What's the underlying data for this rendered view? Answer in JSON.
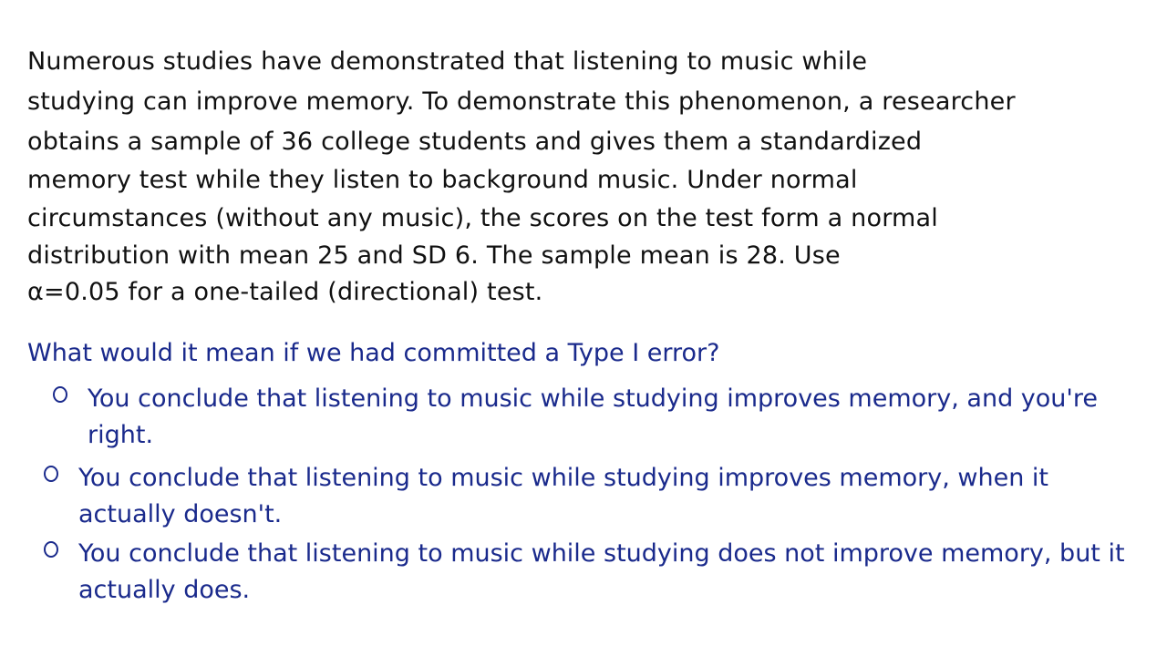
{
  "problem": {
    "lines": [
      "Numerous studies have demonstrated that listening to music while",
      "studying can improve memory. To demonstrate this phenomenon, a researcher",
      "obtains a sample of 36 college students and gives them a standardized",
      "memory test while they listen to background music. Under normal",
      "circumstances (without any music), the scores on the test form a normal",
      "distribution with mean 25 and SD 6. The sample mean is 28. Use",
      "α=0.05 for a one-tailed (directional) test."
    ]
  },
  "question": "What would it mean if we had committed a Type I error?",
  "options": [
    "You conclude that listening to music while studying improves memory, and you're right.",
    "You conclude that listening to music while studying improves memory, when it actually doesn't.",
    "You conclude that listening to music while studying does not improve memory, but it actually does."
  ],
  "colors": {
    "text": "#111111",
    "accent": "#1a2a8c"
  }
}
